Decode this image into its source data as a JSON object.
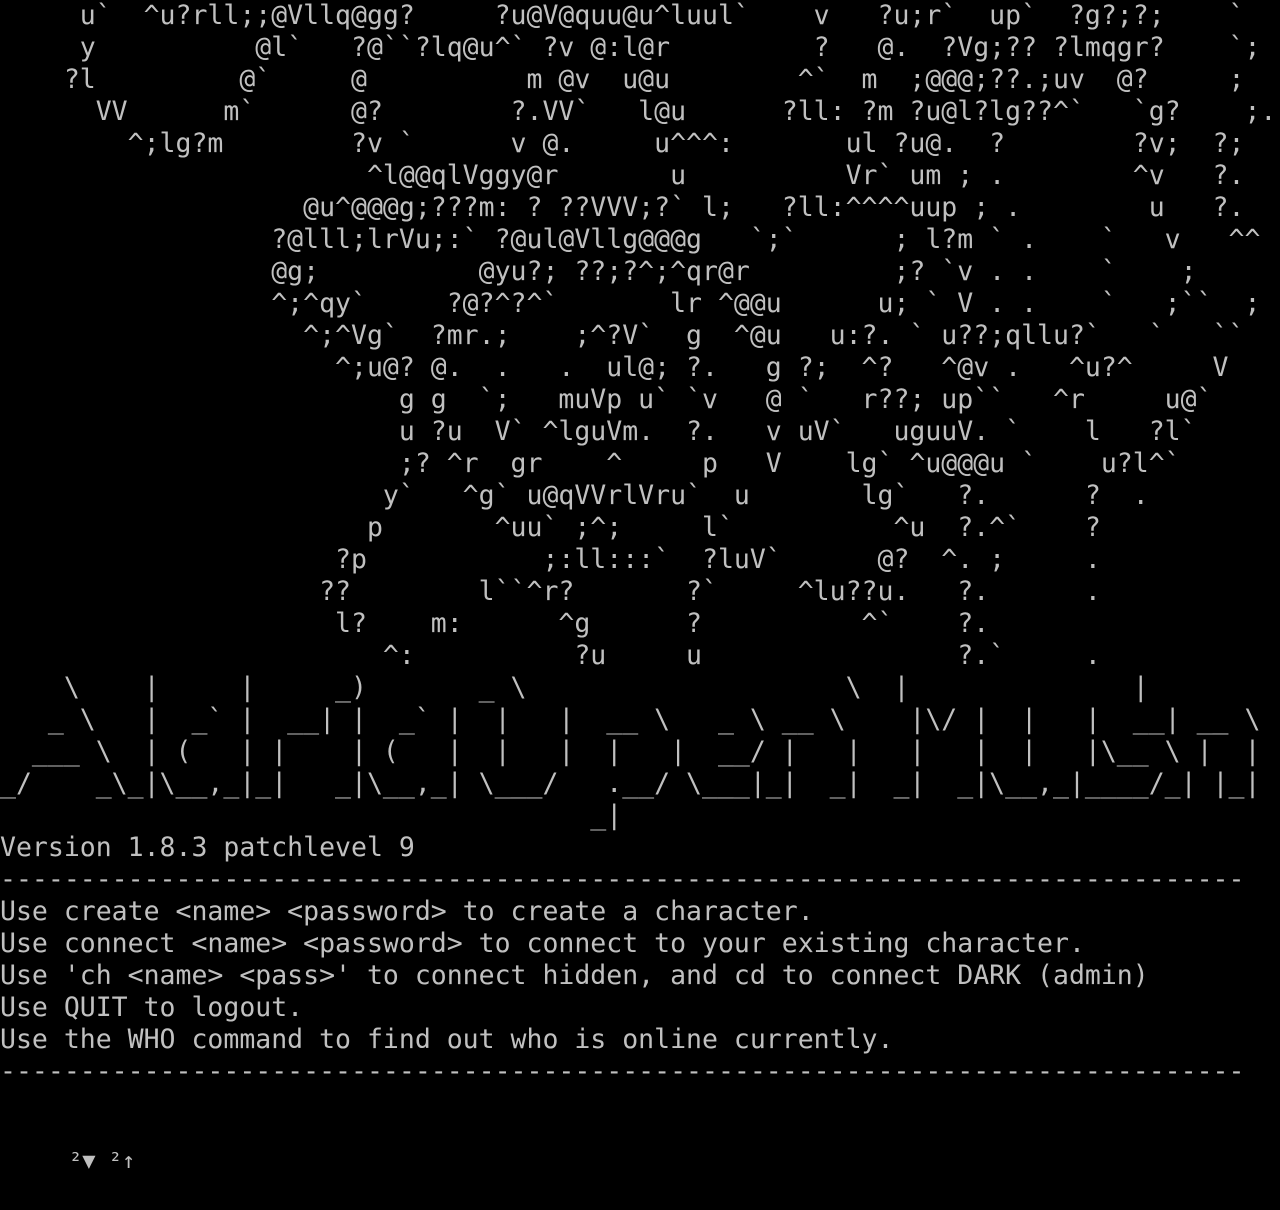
{
  "screen": {
    "background": "#000000",
    "foreground": "#c0c0c0"
  },
  "terminal": {
    "lines": [
      "     u`  ^u?rll;;@Vllq@gg?     ?u@V@quu@u^luul`    v   ?u;r`  up`  ?g?;?;    `",
      "     y          @l`   ?@``?lq@u^` ?v @:l@r         ?   @.  ?Vg;?? ?lmqgr?    `;",
      "    ?l         @`     @          m @v  u@u        ^`  m  ;@@@;??.;uv  @?     ;",
      "      VV      m`      @?        ?.VV`   l@u      ?ll: ?m ?u@l?lg??^`   `g?    ;.",
      "        ^;lg?m        ?v `      v @.     u^^^:       ul ?u@.  ?        ?v;  ?;",
      "                       ^l@@qlVggy@r       u          Vr` um ; .        ^v   ?.",
      "                   @u^@@@g;???m: ? ??VVV;?` l;   ?ll:^^^^uup ; .        u   ?.",
      "                 ?@lll;lrVu;:` ?@ul@Vllg@@@g   `;`      ; l?m ` .    `   v   ^^",
      "                 @g;          @yu?; ??;?^;^qr@r         ;? `v . .    `    ;",
      "                 ^;^qy`     ?@?^?^`       lr ^@@u      u; ` V . .    `   ;``  ;",
      "                   ^;^Vg`  ?mr.;    ;^?V`  g  ^@u   u:?. ` u??;qllu?`   `   ``",
      "                     ^;u@? @.  .   .  ul@; ?.   g ?;  ^?   ^@v .   ^u?^     V",
      "                         g g  `;   muVp u` `v   @ `   r??; up``   ^r     u@`",
      "                         u ?u  V` ^lguVm.  ?.   v uV`   uguuV. `    l   ?l`",
      "                         ;? ^r  gr    ^     p   V    lg` ^u@@@u `    u?l^`",
      "                        y`   ^g` u@qVVrlVru`  u       lg`   ?.      ?  .",
      "                       p       ^uu` ;^;     l`          ^u  ?.^`    ?",
      "                     ?p           ;:ll:::`  ?luV`      @?  ^. ;     .",
      "                    ??        l``^r?       ?`     ^lu??u.   ?.      .",
      "                     l?    m:      ^g      ?          ^`    ?.",
      "                        ^:          ?u     u                ?.`     .",
      "    \\    |     |     _)       _ \\                    \\  |              |",
      "   _ \\   |  _` |  __| |  _` |  |   |  __ \\   _ \\ __ \\    |\\/ |  |   |  __| __ \\",
      "  ___ \\  | (   | |    | (   |  |   |  |   |  __/ |   |   |   |  |   |\\__ \\ |  |",
      "_/    _\\_|\\__,_|_|   _|\\__,_| \\___/   .__/ \\___|_|  _|  _|  _|\\__,_|____/_| |_|",
      "                                     _|",
      "Version 1.8.3 patchlevel 9",
      "------------------------------------------------------------------------------",
      "Use create <name> <password> to create a character.",
      "Use connect <name> <password> to connect to your existing character.",
      "Use 'ch <name> <pass>' to connect hidden, and cd to connect DARK (admin)",
      "Use QUIT to logout.",
      "Use the WHO command to find out who is online currently.",
      "------------------------------------------------------------------------------"
    ],
    "prompt": "²▼ ²↑"
  }
}
